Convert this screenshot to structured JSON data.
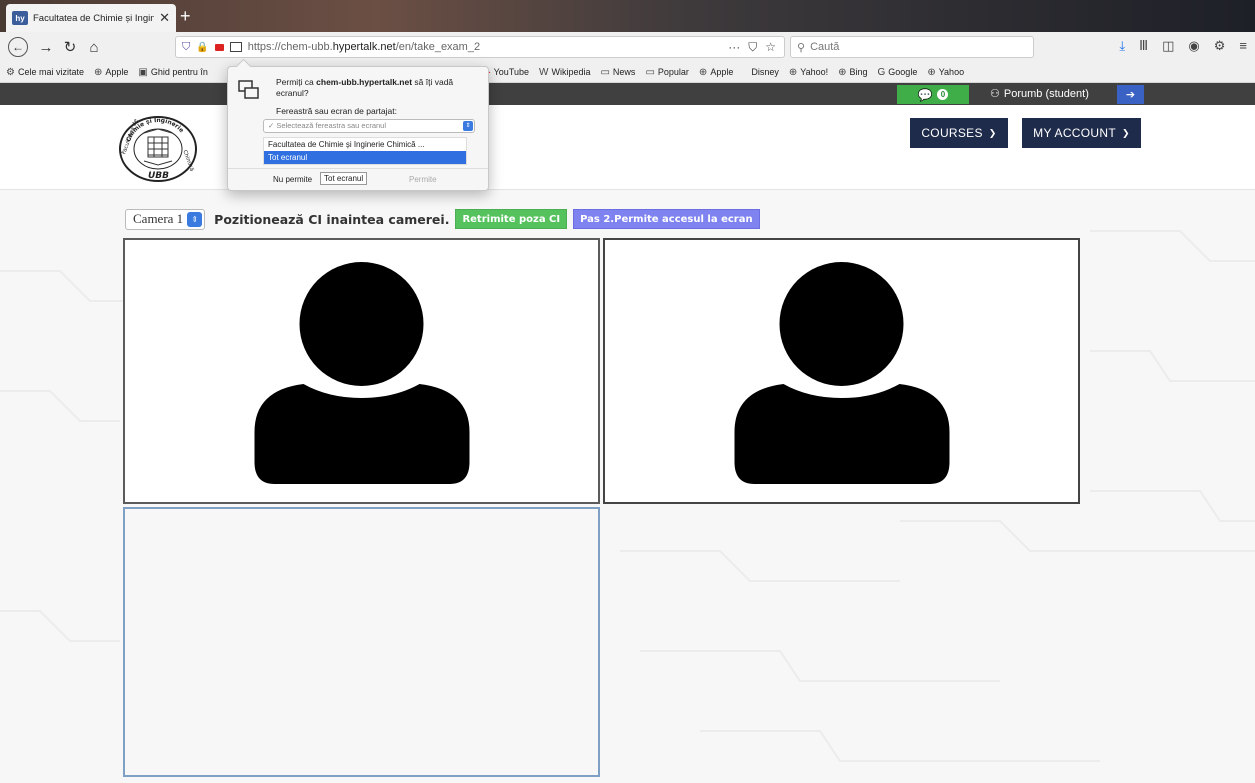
{
  "browser": {
    "tab_title": "Facultatea de Chimie și Inginer",
    "tab_favicon_text": "hy",
    "url_prefix": "https://chem-ubb.",
    "url_domain": "hypertalk.net",
    "url_suffix": "/en/take_exam_2",
    "url_more": "···",
    "search_placeholder": "Caută"
  },
  "bookmarks": [
    {
      "label": "Cele mai vizitate",
      "icon": "gear-icon"
    },
    {
      "label": "Apple",
      "icon": "globe-icon"
    },
    {
      "label": "Ghid pentru în",
      "icon": "book-icon"
    },
    {
      "label": "YouTube",
      "icon": "youtube-icon"
    },
    {
      "label": "Wikipedia",
      "icon": "wikipedia-icon"
    },
    {
      "label": "News",
      "icon": "folder-icon"
    },
    {
      "label": "Popular",
      "icon": "folder-icon"
    },
    {
      "label": "Apple",
      "icon": "globe-icon"
    },
    {
      "label": "Disney",
      "icon": ""
    },
    {
      "label": "Yahoo!",
      "icon": "globe-icon"
    },
    {
      "label": "Bing",
      "icon": "globe-icon"
    },
    {
      "label": "Google",
      "icon": "google-icon"
    },
    {
      "label": "Yahoo",
      "icon": "globe-icon"
    }
  ],
  "site": {
    "chat_count": "0",
    "user_label": "Porumb (student)",
    "logo_top_text": "Chimie și Inginerie",
    "logo_left_text": "Facultatea de",
    "logo_right_text": "Chimică",
    "logo_bottom_text": "UBB",
    "nav": {
      "courses": "COURSES",
      "account": "MY ACCOUNT"
    }
  },
  "exam": {
    "camera_select": "Camera 1",
    "instruction": "Pozitionează CI inaintea camerei.",
    "resend_button": "Retrimite poza CI",
    "step2_button": "Pas 2.Permite accesul la ecran"
  },
  "popup": {
    "question_prefix": "Permiți ca ",
    "question_domain": "chem-ubb.hypertalk.net",
    "question_suffix": " să îți vadă ecranul?",
    "select_label": "Fereastră sau ecran de partajat:",
    "select_placeholder": "✓ Selectează fereastra sau ecranul",
    "options": [
      "Facultatea de Chimie și Inginerie Chimică ...",
      "Tot ecranul"
    ],
    "deny_label": "Nu permite",
    "tooltip": "Tot ecranul",
    "allow_label": "Permite"
  },
  "colors": {
    "green": "#55c25e",
    "blue": "#7f83f0",
    "navy": "#1f2b4a",
    "dark_bar": "#404040"
  }
}
